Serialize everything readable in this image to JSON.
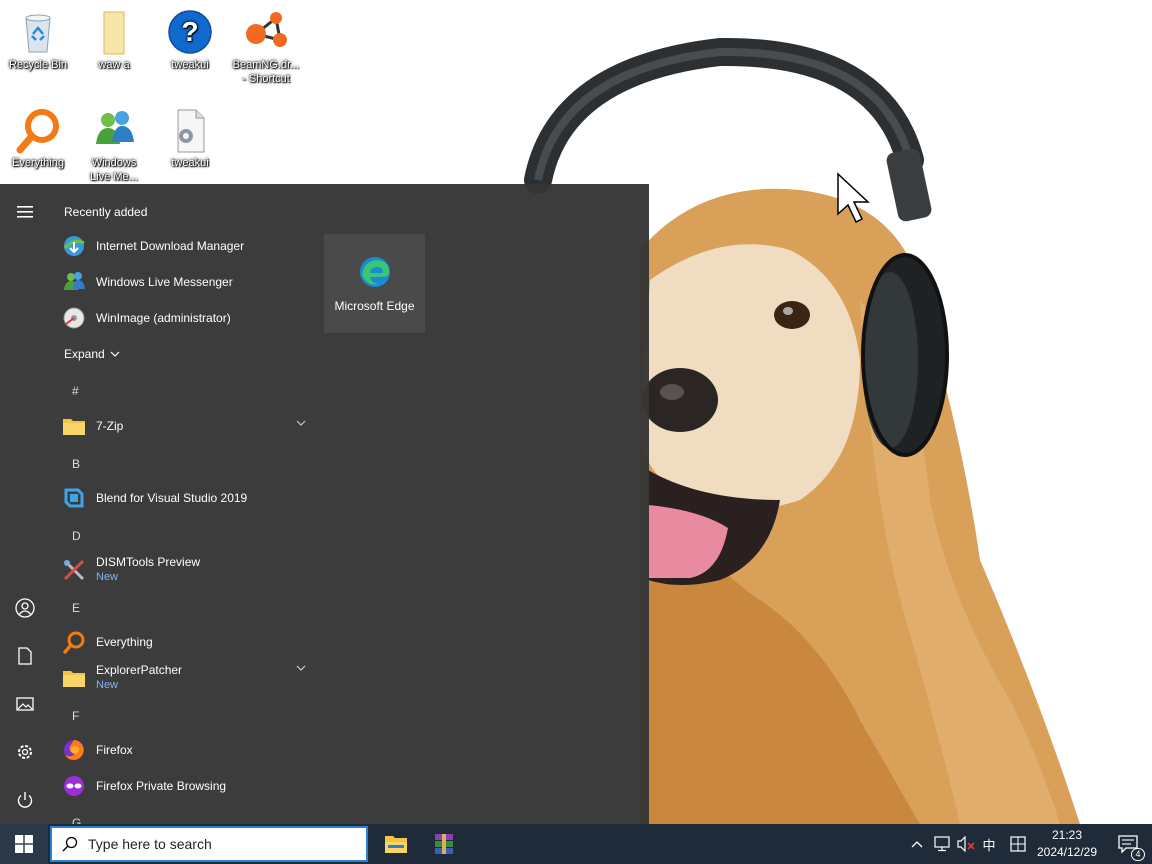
{
  "desktop": {
    "icons": [
      {
        "label": "Recycle Bin",
        "icon": "recycle-bin-icon"
      },
      {
        "label": "waw a",
        "icon": "folder-icon"
      },
      {
        "label": "tweakui",
        "icon": "help-icon"
      },
      {
        "label": "BeamNG.dr...",
        "label2": "- Shortcut",
        "icon": "beamng-icon"
      },
      {
        "label": "Everything",
        "icon": "everything-icon"
      },
      {
        "label": "Windows",
        "label2": "Live Me...",
        "icon": "messenger-icon"
      },
      {
        "label": "tweakui",
        "icon": "settings-file-icon"
      }
    ]
  },
  "start_menu": {
    "recently_added": "Recently added",
    "recent": [
      {
        "label": "Internet Download Manager",
        "icon": "idm-icon"
      },
      {
        "label": "Windows Live Messenger",
        "icon": "messenger-icon"
      },
      {
        "label": "WinImage (administrator)",
        "icon": "winimage-icon"
      }
    ],
    "expand": "Expand",
    "groups": [
      {
        "letter": "#"
      },
      {
        "letter": "B"
      },
      {
        "letter": "D"
      },
      {
        "letter": "E"
      },
      {
        "letter": "F"
      },
      {
        "letter": "G"
      }
    ],
    "apps": [
      {
        "label": "7-Zip",
        "icon": "folder-icon",
        "expandable": true
      },
      {
        "label": "Blend for Visual Studio 2019",
        "icon": "blend-icon"
      },
      {
        "label": "DISMTools Preview",
        "sub": "New",
        "icon": "tools-icon"
      },
      {
        "label": "Everything",
        "icon": "everything-icon"
      },
      {
        "label": "ExplorerPatcher",
        "sub": "New",
        "icon": "folder-icon",
        "expandable": true
      },
      {
        "label": "Firefox",
        "icon": "firefox-icon"
      },
      {
        "label": "Firefox Private Browsing",
        "icon": "firefox-private-icon"
      }
    ],
    "tiles": [
      {
        "label": "Microsoft Edge",
        "icon": "edge-icon"
      }
    ],
    "rail": [
      "menu-icon",
      "user-icon",
      "documents-icon",
      "pictures-icon",
      "settings-icon",
      "power-icon"
    ]
  },
  "taskbar": {
    "search_placeholder": "Type here to search",
    "pinned": [
      "file-explorer-icon",
      "winrar-icon"
    ],
    "tray": {
      "ime": "中",
      "time": "21:23",
      "date": "2024/12/29",
      "notification_count": "4"
    }
  },
  "colors": {
    "taskbar": "#1f2b38",
    "start_menu": "#363636",
    "tile": "#4a4a4a",
    "accent": "#2b7fd6",
    "new_badge": "#7fb4f0"
  }
}
